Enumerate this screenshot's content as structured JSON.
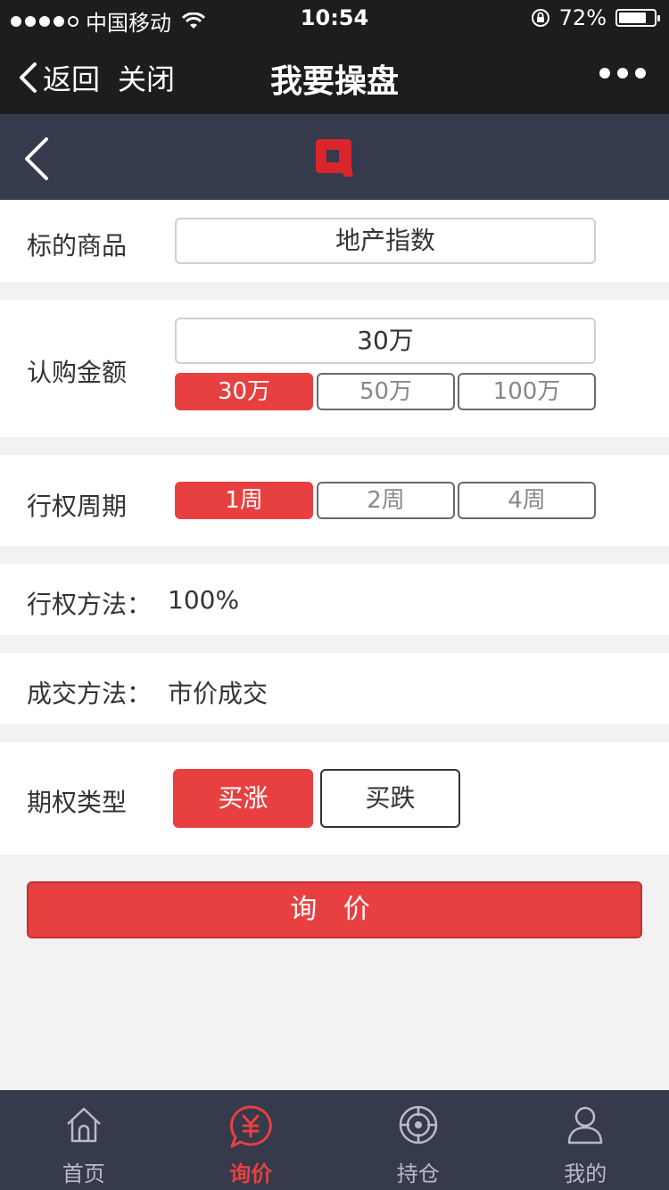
{
  "status": {
    "carrier": "中国移动",
    "time": "10:54",
    "battery": "72%",
    "battery_level": 0.72
  },
  "nav": {
    "back": "返回",
    "close": "关闭",
    "title": "我要操盘"
  },
  "form": {
    "underlying": {
      "label": "标的商品",
      "value": "地产指数"
    },
    "amount": {
      "label": "认购金额",
      "value": "30万",
      "options": [
        "30万",
        "50万",
        "100万"
      ],
      "selected": 0
    },
    "period": {
      "label": "行权周期",
      "options": [
        "1周",
        "2周",
        "4周"
      ],
      "selected": 0
    },
    "exercise": {
      "label": "行权方法：",
      "value": "100%"
    },
    "deal": {
      "label": "成交方法：",
      "value": "市价成交"
    },
    "type": {
      "label": "期权类型",
      "options": [
        "买涨",
        "买跌"
      ],
      "selected": 0
    }
  },
  "inquire_button": "询 价",
  "tabs": [
    {
      "label": "首页",
      "icon": "home-icon",
      "active": false
    },
    {
      "label": "询价",
      "icon": "yuan-chat-icon",
      "active": true
    },
    {
      "label": "持仓",
      "icon": "target-icon",
      "active": false
    },
    {
      "label": "我的",
      "icon": "user-icon",
      "active": false
    }
  ],
  "colors": {
    "accent": "#e84040",
    "header": "#353a4c",
    "nav": "#1d1d20",
    "background": "#f2f2f2"
  }
}
